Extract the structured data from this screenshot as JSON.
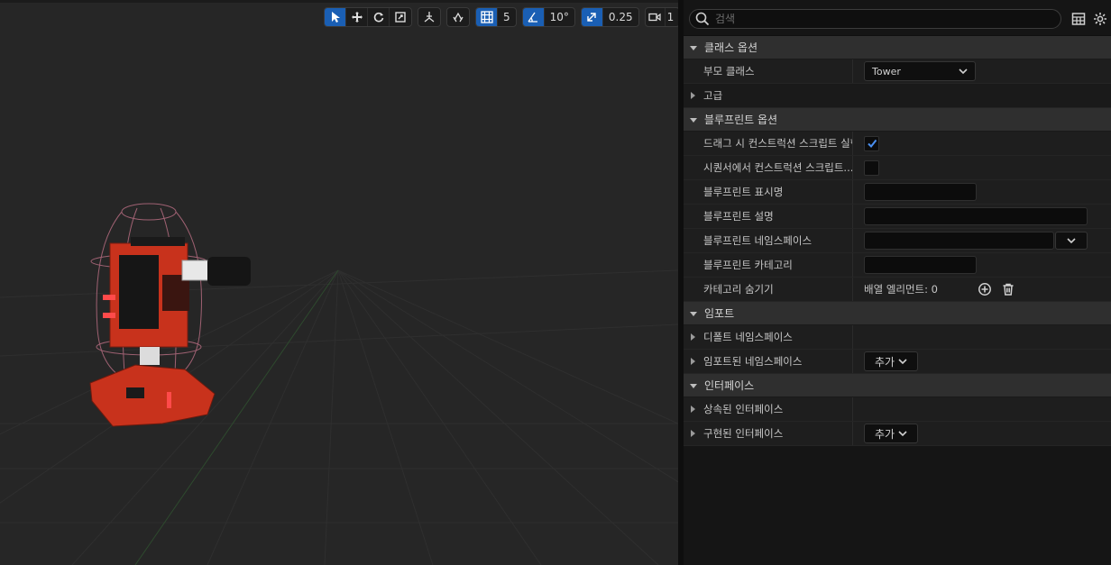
{
  "toolbar": {
    "select_icon": "select-arrow-icon",
    "translate_icon": "translate-icon",
    "rotate_icon": "rotate-icon",
    "scale_icon": "scale-icon",
    "grid_snap_value": "5",
    "rotation_snap_value": "10°",
    "scale_snap_value": "0.25",
    "camera_speed_value": "1"
  },
  "details": {
    "search_placeholder": "검색",
    "sections": {
      "class_options": "클래스 옵션",
      "blueprint_options": "블루프린트 옵션",
      "imports": "임포트",
      "interfaces": "인터페이스"
    },
    "rows": {
      "parent_class_label": "부모 클래스",
      "parent_class_value": "Tower",
      "advanced_label": "고급",
      "run_construction_drag_label": "드래그 시 컨스트럭션 스크립트 실행",
      "run_construction_drag_checked": true,
      "run_construction_seq_label": "시퀀서에서 컨스트럭션 스크립트...",
      "run_construction_seq_checked": false,
      "bp_display_name_label": "블루프린트 표시명",
      "bp_description_label": "블루프린트 설명",
      "bp_namespace_label": "블루프린트 네임스페이스",
      "bp_category_label": "블루프린트 카테고리",
      "hide_categories_label": "카테고리 숨기기",
      "hide_categories_value": "배열 엘리먼트: 0",
      "default_namespaces_label": "디폴트 네임스페이스",
      "imported_namespaces_label": "임포트된 네임스페이스",
      "imported_namespaces_add": "추가",
      "inherited_interfaces_label": "상속된 인터페이스",
      "implemented_interfaces_label": "구현된 인터페이스",
      "implemented_interfaces_add": "추가"
    }
  },
  "colors": {
    "accent": "#1a5fb4",
    "panel_bg": "#151515",
    "section_bg": "#2f2f2f",
    "row_bg": "#1e1e1e",
    "viewport_bg": "#262626",
    "tower_red": "#c8321c"
  }
}
